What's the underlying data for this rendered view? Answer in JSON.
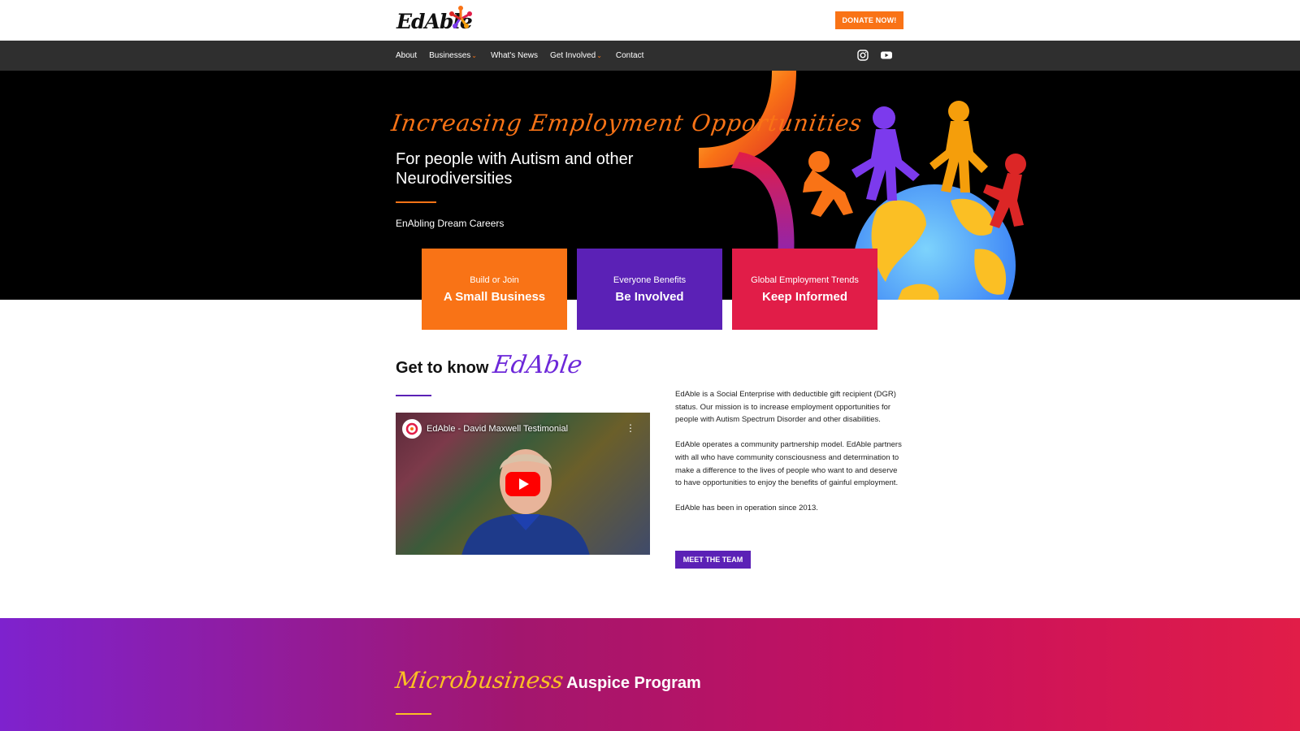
{
  "header": {
    "logo_text": "EdAble",
    "donate_label": "DONATE NOW!"
  },
  "nav": {
    "items": [
      {
        "label": "About",
        "dropdown": false
      },
      {
        "label": "Businesses",
        "dropdown": true
      },
      {
        "label": "What's News",
        "dropdown": false
      },
      {
        "label": "Get Involved",
        "dropdown": true
      },
      {
        "label": "Contact",
        "dropdown": false
      }
    ],
    "social": [
      "instagram-icon",
      "youtube-icon"
    ]
  },
  "hero": {
    "script_title": "Increasing Employment Opportunities",
    "title": "For people with Autism and other Neurodiversities",
    "tagline": "EnAbling Dream Careers"
  },
  "cards": [
    {
      "small": "Build or Join",
      "big": "A Small Business",
      "color": "#f97316"
    },
    {
      "small": "Everyone Benefits",
      "big": "Be Involved",
      "color": "#5b21b6"
    },
    {
      "small": "Global Employment Trends",
      "big": "Keep Informed",
      "color": "#e11d48"
    }
  ],
  "get_to_know": {
    "title_plain": "Get to know",
    "title_script": "EdAble"
  },
  "video": {
    "title": "EdAble - David Maxwell Testimonial"
  },
  "about": {
    "paragraphs": [
      "EdAble is a Social Enterprise with deductible gift recipient (DGR) status. Our mission is to increase employment opportunities for people with Autism Spectrum Disorder and other disabilities.",
      "EdAble operates a community partnership model. EdAble partners with all who have community consciousness and determination to make a difference to the lives of people who want to and deserve to have opportunities to enjoy the benefits of gainful employment.",
      "EdAble has been in operation since 2013."
    ],
    "team_button": "MEET THE TEAM"
  },
  "microbusiness": {
    "title_script": "Microbusiness",
    "title_plain": "Auspice Program"
  },
  "colors": {
    "orange": "#f97316",
    "purple": "#5b21b6",
    "red": "#e11d48",
    "nav_bg": "#2f2f2f"
  }
}
